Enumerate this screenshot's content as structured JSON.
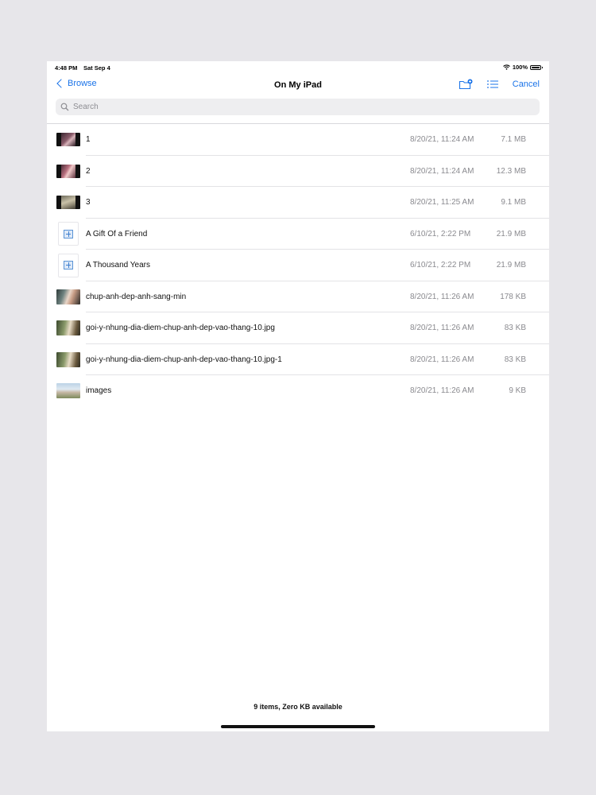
{
  "status_bar": {
    "time": "4:48 PM",
    "date": "Sat Sep 4",
    "battery": "100%"
  },
  "nav": {
    "back_label": "Browse",
    "title": "On My iPad",
    "cancel_label": "Cancel",
    "accent_color": "#1a73e8"
  },
  "search": {
    "placeholder": "Search"
  },
  "files": [
    {
      "name": "1",
      "date": "8/20/21, 11:24 AM",
      "size": "7.1 MB",
      "kind": "video"
    },
    {
      "name": "2",
      "date": "8/20/21, 11:24 AM",
      "size": "12.3 MB",
      "kind": "video"
    },
    {
      "name": "3",
      "date": "8/20/21, 11:25 AM",
      "size": "9.1 MB",
      "kind": "video"
    },
    {
      "name": "A Gift Of a Friend",
      "date": "6/10/21, 2:22 PM",
      "size": "21.9 MB",
      "kind": "audio"
    },
    {
      "name": "A Thousand Years",
      "date": "6/10/21, 2:22 PM",
      "size": "21.9 MB",
      "kind": "audio"
    },
    {
      "name": "chup-anh-dep-anh-sang-min",
      "date": "8/20/21, 11:26 AM",
      "size": "178 KB",
      "kind": "photo"
    },
    {
      "name": "goi-y-nhung-dia-diem-chup-anh-dep-vao-thang-10.jpg",
      "date": "8/20/21, 11:26 AM",
      "size": "83 KB",
      "kind": "photo"
    },
    {
      "name": "goi-y-nhung-dia-diem-chup-anh-dep-vao-thang-10.jpg-1",
      "date": "8/20/21, 11:26 AM",
      "size": "83 KB",
      "kind": "photo"
    },
    {
      "name": "images",
      "date": "8/20/21, 11:26 AM",
      "size": "9 KB",
      "kind": "photo"
    }
  ],
  "footer": {
    "status": "9 items, Zero KB available"
  }
}
